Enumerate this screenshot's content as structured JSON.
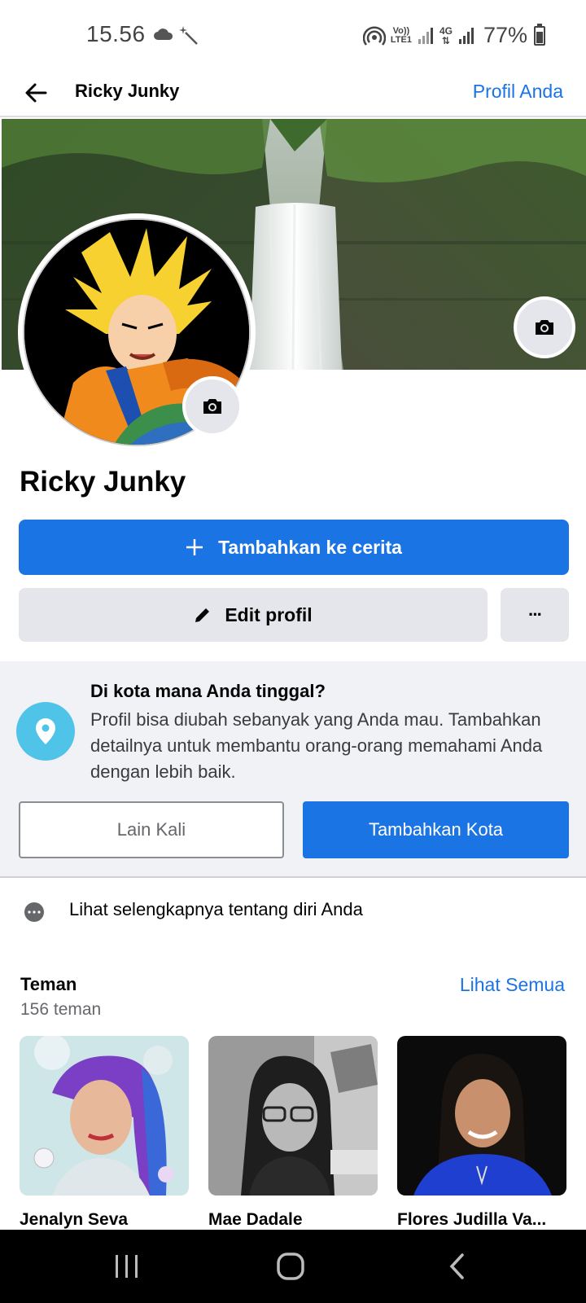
{
  "status_bar": {
    "time": "15.56",
    "volte_line1": "Vo))",
    "volte_line2": "LTE1",
    "network": "4G",
    "battery": "77%"
  },
  "header": {
    "title": "Ricky Junky",
    "right_link": "Profil Anda"
  },
  "profile": {
    "name": "Ricky Junky"
  },
  "actions": {
    "story_label": "Tambahkan ke cerita",
    "edit_label": "Edit profil",
    "more_label": "···"
  },
  "prompt": {
    "title": "Di kota mana Anda tinggal?",
    "description": "Profil bisa diubah sebanyak yang Anda mau. Tambahkan detailnya untuk membantu orang-orang memahami Anda dengan lebih baik.",
    "later_label": "Lain Kali",
    "add_city_label": "Tambahkan Kota"
  },
  "about": {
    "text": "Lihat selengkapnya tentang diri Anda"
  },
  "friends": {
    "title": "Teman",
    "count": "156 teman",
    "see_all": "Lihat Semua",
    "items": [
      {
        "name": "Jenalyn Seva"
      },
      {
        "name": "Mae Dadale"
      },
      {
        "name": "Flores Judilla Va..."
      }
    ]
  },
  "colors": {
    "accent": "#1b74e4",
    "button_grey": "#e4e6eb",
    "prompt_bg": "#f0f2f5",
    "pin": "#4fc3e8"
  },
  "icons": {
    "back": "arrow-left-icon",
    "camera": "camera-icon",
    "plus": "plus-icon",
    "pencil": "pencil-icon",
    "pin": "location-pin-icon"
  }
}
